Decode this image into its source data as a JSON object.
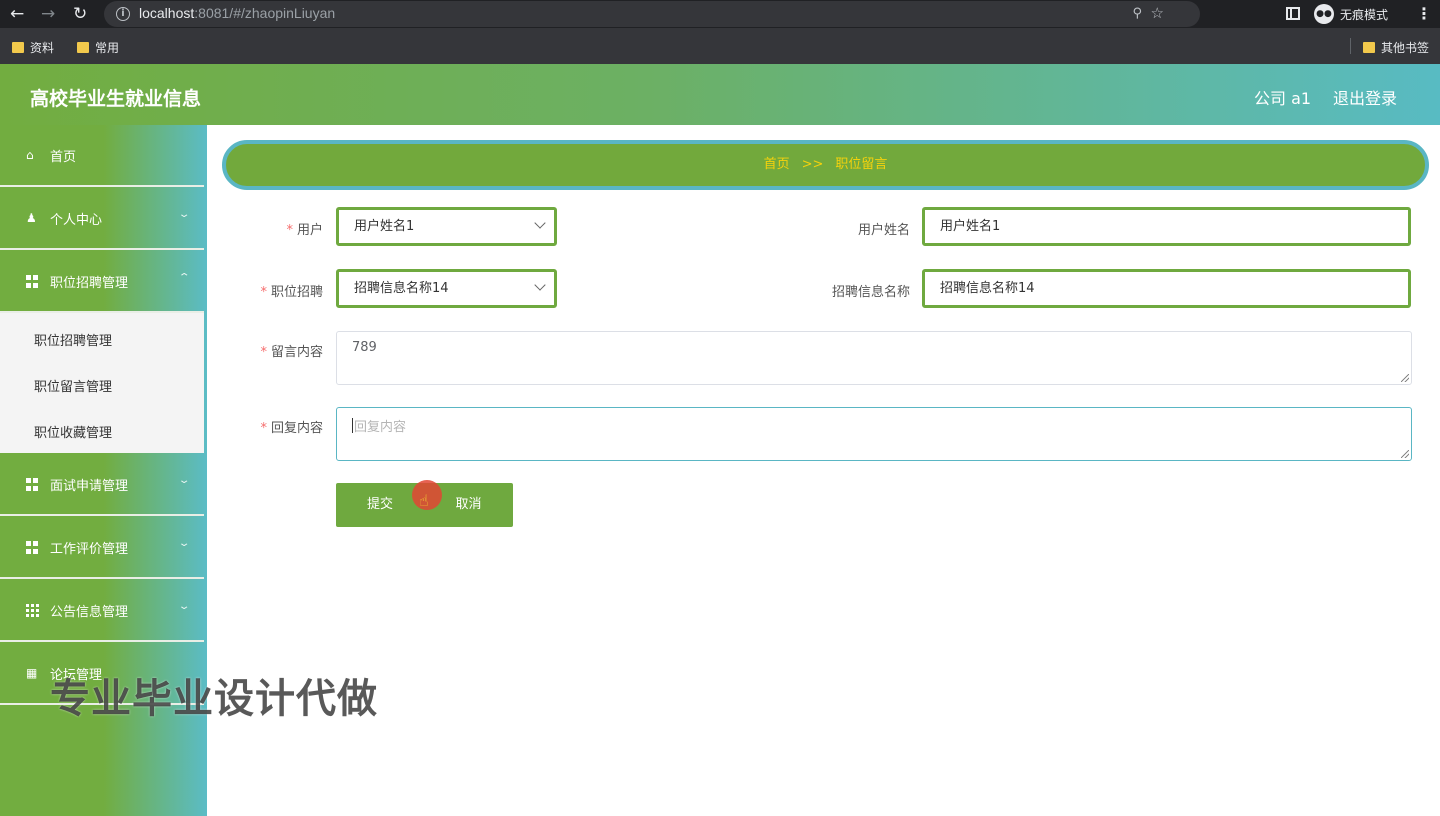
{
  "browser": {
    "url_host": "localhost",
    "url_rest": ":8081/#/zhaopinLiuyan",
    "incognito_label": "无痕模式",
    "bookmarks": [
      "资料",
      "常用"
    ],
    "other_bookmarks": "其他书签"
  },
  "header": {
    "title": "高校毕业生就业信息",
    "user": "公司 a1",
    "logout": "退出登录"
  },
  "sidebar": {
    "items": [
      {
        "label": "首页",
        "icon": "home-icon"
      },
      {
        "label": "个人中心",
        "icon": "user-icon"
      },
      {
        "label": "职位招聘管理",
        "icon": "grid-icon"
      },
      {
        "label": "面试申请管理",
        "icon": "grid-icon"
      },
      {
        "label": "工作评价管理",
        "icon": "grid-icon"
      },
      {
        "label": "公告信息管理",
        "icon": "grid9-icon"
      },
      {
        "label": "论坛管理",
        "icon": "clipboard-icon"
      }
    ],
    "submenu": [
      "职位招聘管理",
      "职位留言管理",
      "职位收藏管理"
    ]
  },
  "breadcrumb": {
    "home": "首页",
    "separator": ">>",
    "current": "职位留言"
  },
  "form": {
    "user_label": "用户",
    "user_value": "用户姓名1",
    "username_label": "用户姓名",
    "username_value": "用户姓名1",
    "job_label": "职位招聘",
    "job_value": "招聘信息名称14",
    "jobname_label": "招聘信息名称",
    "jobname_value": "招聘信息名称14",
    "message_label": "留言内容",
    "message_value": "789",
    "reply_label": "回复内容",
    "reply_placeholder": "回复内容",
    "submit": "提交",
    "cancel": "取消"
  },
  "watermark": "专业毕业设计代做",
  "colors": {
    "primary_green": "#6fa93f",
    "accent_teal": "#5ab6c4",
    "breadcrumb_text": "#f5d20c"
  }
}
